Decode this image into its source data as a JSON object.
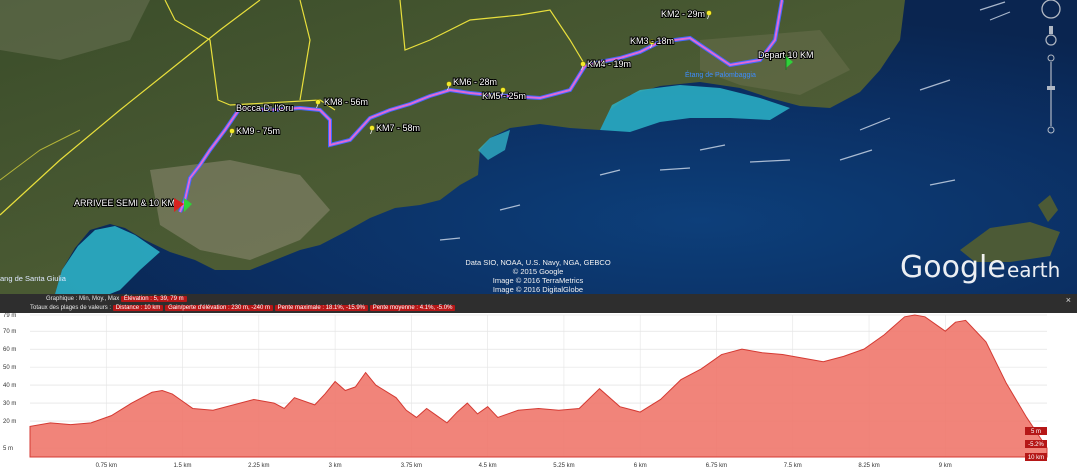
{
  "map": {
    "km_markers": [
      {
        "label": "KM2 - 29m",
        "icon": "yellow-pushpin-icon"
      },
      {
        "label": "KM3 - 18m",
        "icon": "yellow-pushpin-icon"
      },
      {
        "label": "KM4 - 19m",
        "icon": "yellow-pushpin-icon"
      },
      {
        "label": "KM5 - 25m",
        "icon": "yellow-pushpin-icon"
      },
      {
        "label": "KM6 - 28m",
        "icon": "yellow-pushpin-icon"
      },
      {
        "label": "KM7 - 58m",
        "icon": "yellow-pushpin-icon"
      },
      {
        "label": "KM8 - 56m",
        "icon": "yellow-pushpin-icon"
      },
      {
        "label": "KM9 - 75m",
        "icon": "yellow-pushpin-icon"
      }
    ],
    "start_label": "Depart 10 KM",
    "finish_label": "ARRIVEE SEMI & 10 KM",
    "place_label": "Bocca Di l'Oru",
    "lake_label": "Étang de Palombaggia",
    "bottom_left_label": "ang de Santa Giulia",
    "attribution": [
      "Data SIO, NOAA, U.S. Navy, NGA, GEBCO",
      "© 2015 Google",
      "Image © 2016 TerraMetrics",
      "Image © 2016 DigitalGlobe"
    ],
    "logo_google": "Google",
    "logo_earth": "earth"
  },
  "profile_panel": {
    "row1_label": "Graphique : Min, Moy., Max",
    "row1_value": "Élévation : 5, 39, 79 m",
    "row2_label": "Totaux des plages de valeurs :",
    "row2_distance": "Distance : 10 km",
    "row2_gain": "Gain/perte d'élévation : 230 m, -240 m",
    "row2_slope_max": "Pente maximale : 18.1%, -15.9%",
    "row2_slope_avg": "Pente moyenne : 4.1%, -5.0%",
    "close": "×",
    "end_badges": {
      "elevation": "5 m",
      "slope": "-5.2%",
      "distance": "10 km"
    }
  },
  "chart_data": {
    "type": "area",
    "xlabel": "",
    "ylabel": "",
    "x_unit": "km",
    "y_unit": "m",
    "xlim": [
      0,
      10
    ],
    "ylim": [
      0,
      79
    ],
    "x_ticks": [
      "0.75 km",
      "1.5 km",
      "2.25 km",
      "3 km",
      "3.75 km",
      "4.5 km",
      "5.25 km",
      "6 km",
      "6.75 km",
      "7.5 km",
      "8.25 km",
      "9 km"
    ],
    "x_tick_values": [
      0.75,
      1.5,
      2.25,
      3,
      3.75,
      4.5,
      5.25,
      6,
      6.75,
      7.5,
      8.25,
      9
    ],
    "y_ticks": [
      "5 m",
      "20 m",
      "30 m",
      "40 m",
      "50 m",
      "60 m",
      "70 m",
      "79 m"
    ],
    "y_tick_values": [
      5,
      20,
      30,
      40,
      50,
      60,
      70,
      79
    ],
    "x": [
      0,
      0.2,
      0.4,
      0.6,
      0.8,
      1.0,
      1.2,
      1.3,
      1.4,
      1.5,
      1.6,
      1.8,
      2.0,
      2.2,
      2.4,
      2.5,
      2.6,
      2.8,
      2.9,
      3.0,
      3.1,
      3.2,
      3.3,
      3.4,
      3.6,
      3.7,
      3.8,
      3.9,
      4.0,
      4.1,
      4.2,
      4.3,
      4.4,
      4.5,
      4.6,
      4.8,
      5.0,
      5.2,
      5.4,
      5.6,
      5.8,
      6.0,
      6.2,
      6.4,
      6.6,
      6.8,
      7.0,
      7.2,
      7.4,
      7.6,
      7.8,
      8.0,
      8.2,
      8.4,
      8.6,
      8.7,
      8.8,
      9.0,
      9.1,
      9.2,
      9.4,
      9.6,
      9.8,
      10.0
    ],
    "y": [
      17,
      19,
      18,
      19,
      23,
      30,
      36,
      37,
      35,
      31,
      27,
      26,
      29,
      32,
      30,
      27,
      33,
      29,
      35,
      42,
      37,
      39,
      47,
      40,
      33,
      26,
      22,
      27,
      23,
      19,
      25,
      30,
      24,
      28,
      22,
      26,
      27,
      26,
      27,
      38,
      28,
      25,
      32,
      43,
      49,
      57,
      60,
      58,
      57,
      55,
      53,
      56,
      60,
      68,
      78,
      79,
      78,
      70,
      75,
      76,
      64,
      41,
      22,
      5
    ]
  }
}
